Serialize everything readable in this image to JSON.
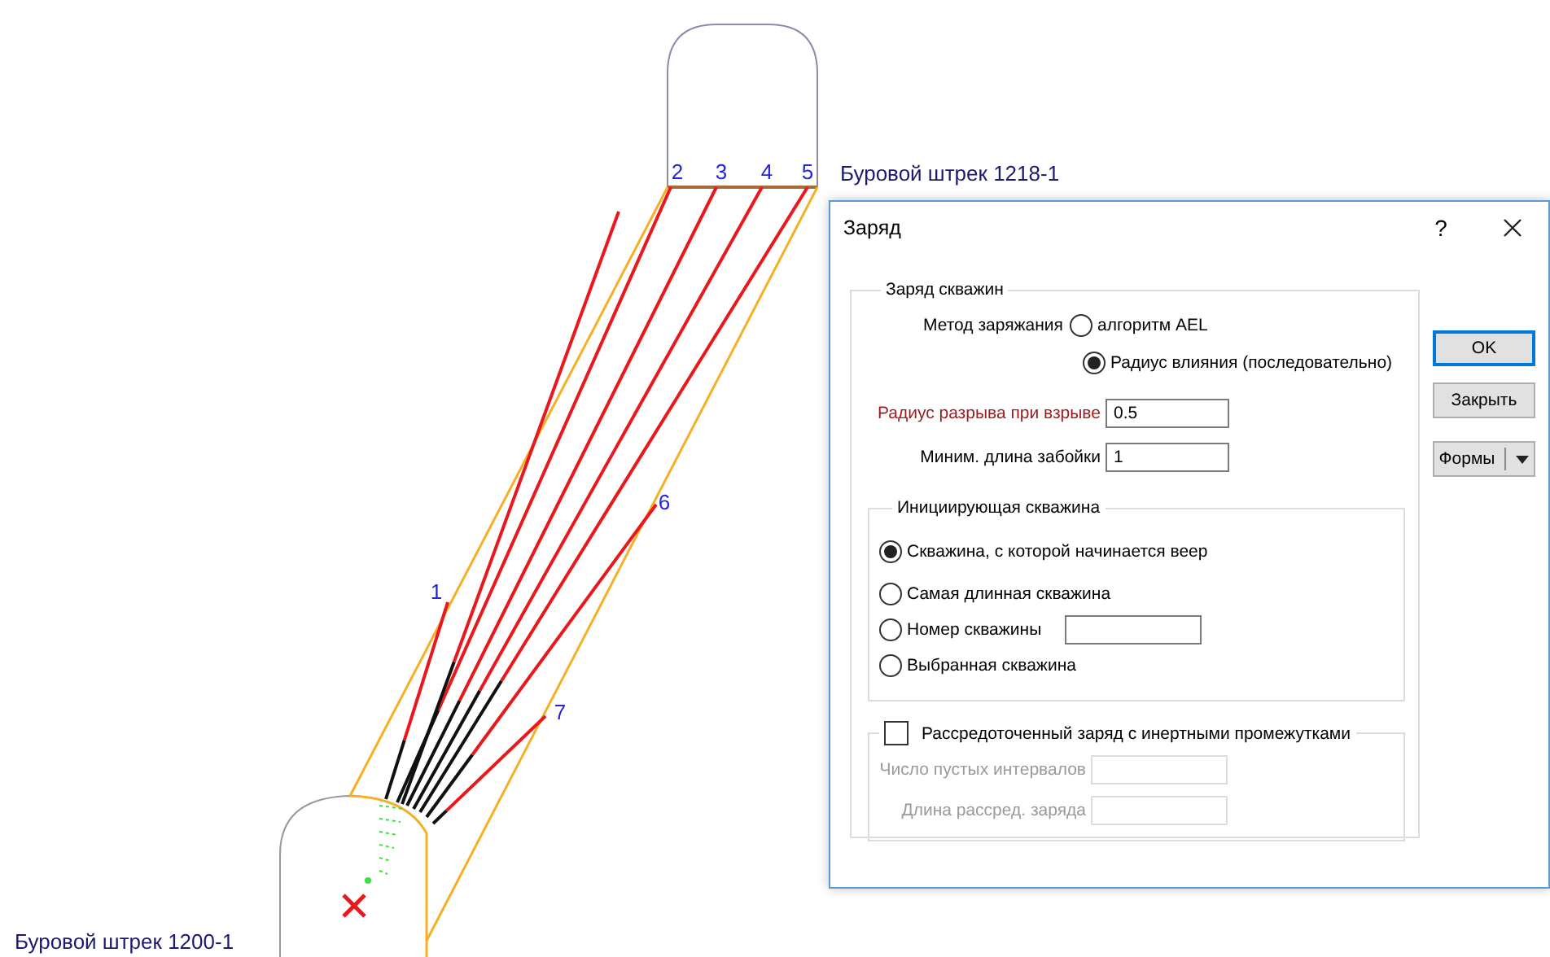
{
  "drawing": {
    "drift_labels": [
      "Буровой штрек 1218-1",
      "Буровой штрек 1200-1"
    ],
    "hole_labels": [
      "1",
      "2",
      "3",
      "4",
      "5",
      "6",
      "7"
    ]
  },
  "dialog": {
    "title": "Заряд",
    "help": "?",
    "charge_group": {
      "title": "Заряд скважин",
      "method_label": "Метод заряжания",
      "methods": [
        {
          "label": "алгоритм AEL",
          "selected": false
        },
        {
          "label": "Радиус влияния (последовательно)",
          "selected": true
        }
      ],
      "fields": [
        {
          "label": "Радиус разрыва при взрыве",
          "value": "0.5",
          "emphasized": true
        },
        {
          "label": "Миним. длина забойки",
          "value": "1",
          "emphasized": false
        }
      ],
      "initiating": {
        "title": "Инициирующая скважина",
        "options": [
          {
            "label": "Скважина, с которой начинается веер",
            "selected": true,
            "kind": "plain"
          },
          {
            "label": "Самая длинная скважина",
            "selected": false,
            "kind": "plain"
          },
          {
            "label": "Номер скважины",
            "selected": false,
            "kind": "field"
          },
          {
            "label": "Выбранная скважина",
            "selected": false,
            "kind": "plain"
          }
        ]
      },
      "dispersed": {
        "label": "Рассредоточенный заряд с инертными промежутками",
        "checked": false,
        "fields": [
          {
            "label": "Число пустых интервалов",
            "disabled": true
          },
          {
            "label": "Длина рассред. заряда",
            "disabled": true
          }
        ]
      }
    },
    "buttons": [
      {
        "label": "OK",
        "default": true,
        "kind": "plain"
      },
      {
        "label": "Закрыть",
        "default": false,
        "kind": "plain"
      },
      {
        "label": "Формы",
        "default": false,
        "kind": "split"
      }
    ]
  }
}
